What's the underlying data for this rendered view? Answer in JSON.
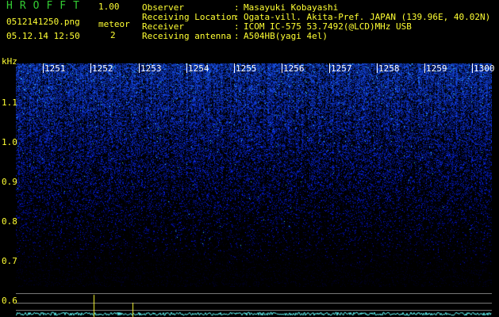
{
  "header": {
    "app_name": "HROFFT",
    "version": "1.00",
    "filename": "0512141250.png",
    "datetime": "05.12.14 12:50",
    "meteor_label": "meteor",
    "meteor_count": "2"
  },
  "station": [
    {
      "label": "Observer",
      "value": "Masayuki Kobayashi"
    },
    {
      "label": "Receiving Location",
      "value": "Ogata-vill. Akita-Pref. JAPAN (139.96E, 40.02N)"
    },
    {
      "label": "Receiver",
      "value": "ICOM IC-575 53.7492(@LCD)MHz USB"
    },
    {
      "label": "Receiving antenna",
      "value": "A504HB(yagi 4el)"
    }
  ],
  "axis": {
    "unit": "kHz",
    "freq_ticks": [
      "1.1",
      "1.0",
      "0.9",
      "0.8",
      "0.7",
      "0.6"
    ],
    "time_ticks": [
      "1251",
      "1252",
      "1253",
      "1254",
      "1255",
      "1256",
      "1257",
      "1258",
      "1259",
      "1300"
    ]
  },
  "colors": {
    "background": "#000000",
    "header_text": "#ffff33",
    "title_text": "#33cc33",
    "noise_dark": "#0a1a80",
    "noise_bright": "#3a78ff",
    "signal": "#66ffff",
    "meteor_spike": "#ffff33"
  }
}
